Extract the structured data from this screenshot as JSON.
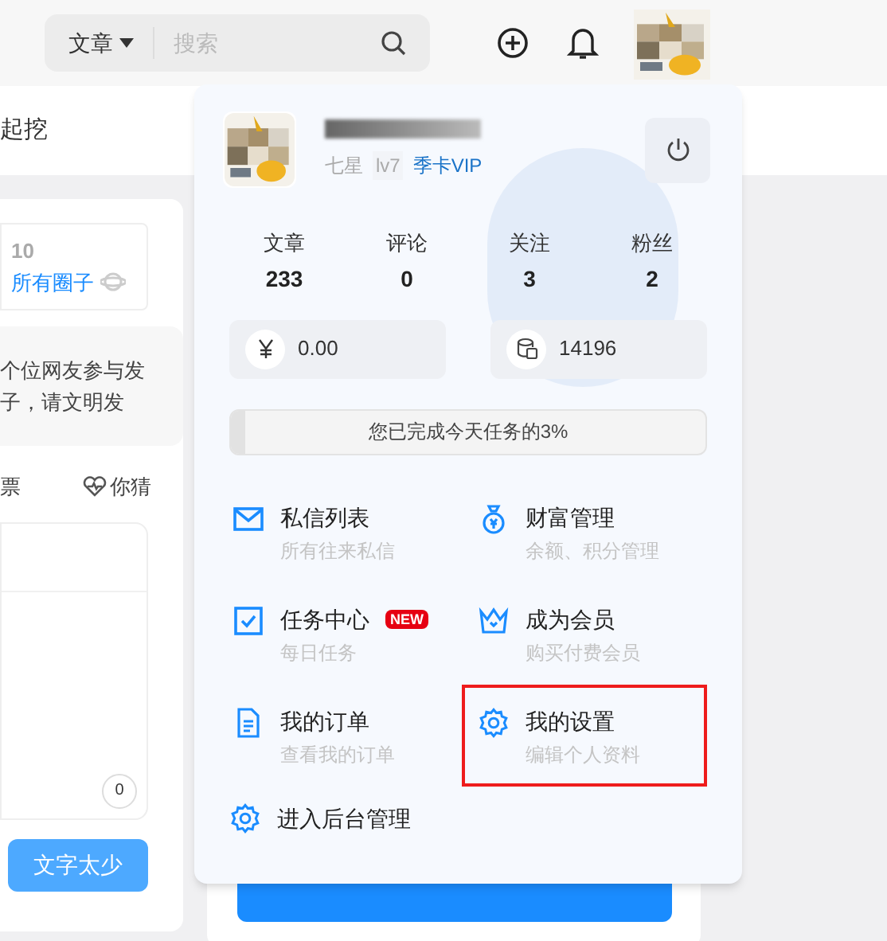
{
  "header": {
    "search": {
      "scope": "文章",
      "placeholder": "搜索"
    }
  },
  "left": {
    "title_fragment": "起挖",
    "circle": {
      "count": "10",
      "link": "所有圈子"
    },
    "notice": [
      "个位网友参与发",
      "子，请文明发"
    ],
    "tabs": [
      {
        "label": "票",
        "selected": false
      },
      {
        "label": "你猜",
        "selected": false
      }
    ],
    "counter": "0",
    "submit": "文字太少"
  },
  "popup": {
    "user": {
      "rank": "七星",
      "level": "lv7",
      "vip": "季卡VIP"
    },
    "stats": [
      {
        "label": "文章",
        "value": "233"
      },
      {
        "label": "评论",
        "value": "0"
      },
      {
        "label": "关注",
        "value": "3"
      },
      {
        "label": "粉丝",
        "value": "2"
      }
    ],
    "wallet": [
      {
        "kind": "money",
        "value": "0.00"
      },
      {
        "kind": "coins",
        "value": "14196"
      }
    ],
    "task": {
      "text": "您已完成今天任务的3%",
      "level": 0.03
    },
    "menu": [
      {
        "kind": "mail",
        "title": "私信列表",
        "subtitle": "所有往来私信",
        "highlighted": false
      },
      {
        "kind": "moneybag",
        "title": "财富管理",
        "subtitle": "余额、积分管理",
        "highlighted": false
      },
      {
        "kind": "task",
        "title": "任务中心",
        "badge": "NEW",
        "subtitle": "每日任务",
        "highlighted": false
      },
      {
        "kind": "crown",
        "title": "成为会员",
        "subtitle": "购买付费会员",
        "highlighted": false
      },
      {
        "kind": "doc",
        "title": "我的订单",
        "subtitle": "查看我的订单",
        "highlighted": false
      },
      {
        "kind": "gear",
        "title": "我的设置",
        "subtitle": "编辑个人资料",
        "highlighted": true
      }
    ],
    "admin": "进入后台管理"
  }
}
